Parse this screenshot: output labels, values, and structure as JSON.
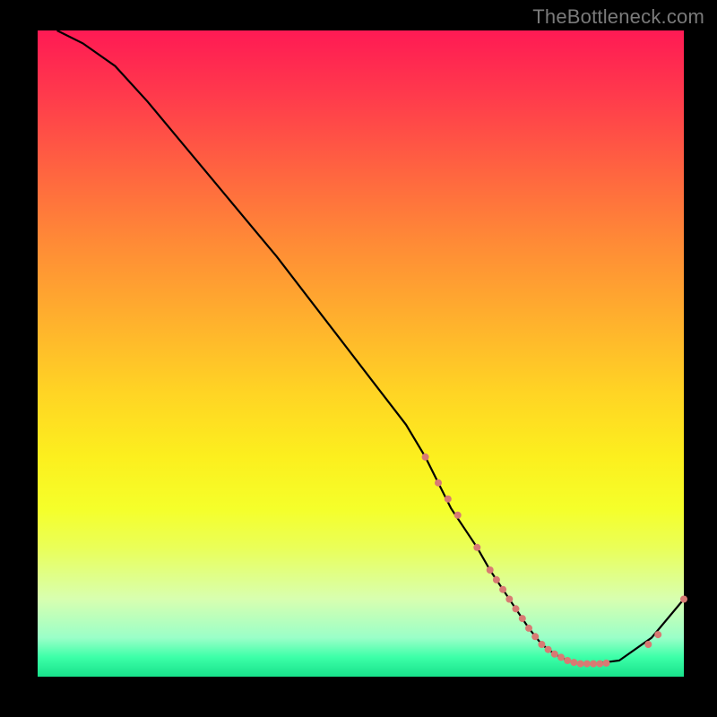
{
  "watermark": "TheBottleneck.com",
  "chart_data": {
    "type": "line",
    "title": "",
    "xlabel": "",
    "ylabel": "",
    "xlim": [
      0,
      100
    ],
    "ylim": [
      0,
      100
    ],
    "x": [
      3,
      7,
      12,
      17,
      22,
      27,
      32,
      37,
      42,
      47,
      52,
      57,
      60,
      62,
      64,
      66,
      68,
      70,
      72,
      74,
      76,
      78,
      80,
      82,
      84,
      86,
      90,
      95,
      100
    ],
    "values": [
      100,
      98,
      94.5,
      89,
      83,
      77,
      71,
      65,
      58.5,
      52,
      45.5,
      39,
      34,
      30,
      26,
      23,
      20,
      16.5,
      13.5,
      10.5,
      7.5,
      5,
      3.5,
      2.5,
      2,
      2,
      2.5,
      6,
      12
    ],
    "points": {
      "x": [
        60,
        62,
        63.5,
        65,
        68,
        70,
        71,
        72,
        73,
        74,
        75,
        76,
        77,
        78,
        79,
        80,
        81,
        82,
        83,
        84,
        85,
        86,
        87,
        88,
        94.5,
        96,
        100
      ],
      "y": [
        34,
        30,
        27.5,
        25,
        20,
        16.5,
        15,
        13.5,
        12,
        10.5,
        9,
        7.5,
        6.2,
        5,
        4.2,
        3.5,
        3,
        2.5,
        2.2,
        2,
        2,
        2,
        2,
        2.1,
        5,
        6.5,
        12
      ],
      "color": "#d87a73",
      "radius": 4
    },
    "line_color": "#000000"
  }
}
